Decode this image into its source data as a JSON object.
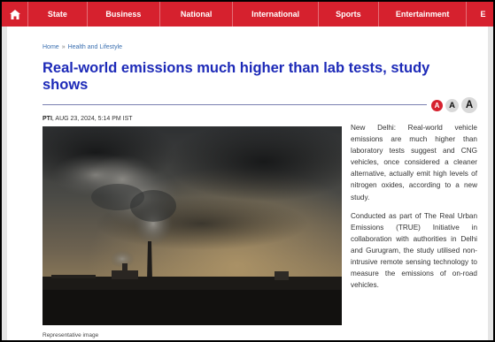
{
  "nav": {
    "items": [
      "State",
      "Business",
      "National",
      "International",
      "Sports",
      "Entertainment",
      "E"
    ]
  },
  "breadcrumb": {
    "home": "Home",
    "separator": "»",
    "section": "Health and Lifestyle"
  },
  "article": {
    "title": "Real-world emissions much higher than lab tests, study shows",
    "author": "PTI",
    "date": ", AUG 23, 2024, 5:14 PM IST",
    "caption": "Representative image",
    "paragraphs": [
      "New Delhi: Real-world vehicle emissions are much higher than laboratory tests suggest and CNG vehicles, once considered a cleaner alternative, actually emit high levels of nitrogen oxides, according to a new study.",
      "Conducted as part of The Real Urban Emissions (TRUE) Initiative in collaboration with authorities in Delhi and Gurugram, the study utilised non-intrusive remote sensing technology to measure the emissions of on-road vehicles."
    ]
  },
  "font_sizer": {
    "small": "A",
    "medium": "A",
    "large": "A"
  },
  "colors": {
    "nav": "#d6212e",
    "title": "#1d2ab8",
    "link": "#3a6fb0"
  }
}
